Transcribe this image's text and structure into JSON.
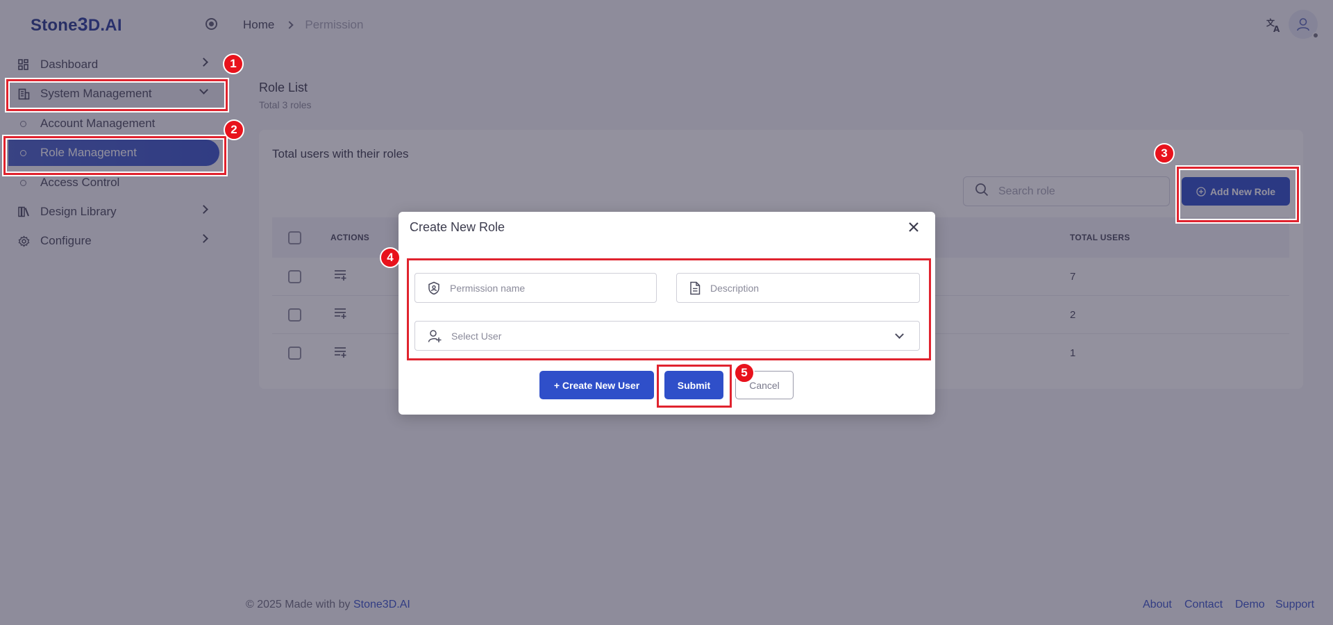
{
  "sidebar": {
    "logo_prefix": "Stone",
    "logo_big": "3",
    "logo_suffix": "D.AI",
    "items": [
      {
        "label": "Dashboard",
        "icon": "dashboard-icon"
      },
      {
        "label": "System Management",
        "icon": "building-icon"
      },
      {
        "label": "Design Library",
        "icon": "library-icon"
      },
      {
        "label": "Configure",
        "icon": "gear-icon"
      }
    ],
    "sub_items": [
      {
        "label": "Account Management"
      },
      {
        "label": "Role Management"
      },
      {
        "label": "Access Control"
      }
    ]
  },
  "header": {
    "breadcrumb_home": "Home",
    "breadcrumb_current": "Permission"
  },
  "main": {
    "title": "Role List",
    "subtitle": "Total 3 roles",
    "card_title": "Total users with their roles",
    "search_placeholder": "Search role",
    "add_button": "Add New Role",
    "columns": {
      "actions": "ACTIONS",
      "total_users": "TOTAL USERS"
    },
    "rows": [
      {
        "total_users": "7"
      },
      {
        "total_users": "2"
      },
      {
        "total_users": "1"
      }
    ]
  },
  "modal": {
    "title": "Create New Role",
    "permission_placeholder": "Permission name",
    "description_placeholder": "Description",
    "select_user_placeholder": "Select User",
    "create_user_button": "+ Create New User",
    "submit_button": "Submit",
    "cancel_button": "Cancel"
  },
  "footer": {
    "copyright": "© 2025 Made with by ",
    "brand": "Stone3D.AI",
    "links": [
      "About",
      "Contact",
      "Demo",
      "Support"
    ]
  },
  "annotations": [
    "1",
    "2",
    "3",
    "4",
    "5"
  ],
  "colors": {
    "primary": "#2f4fc9",
    "annotation": "#e8121c"
  }
}
